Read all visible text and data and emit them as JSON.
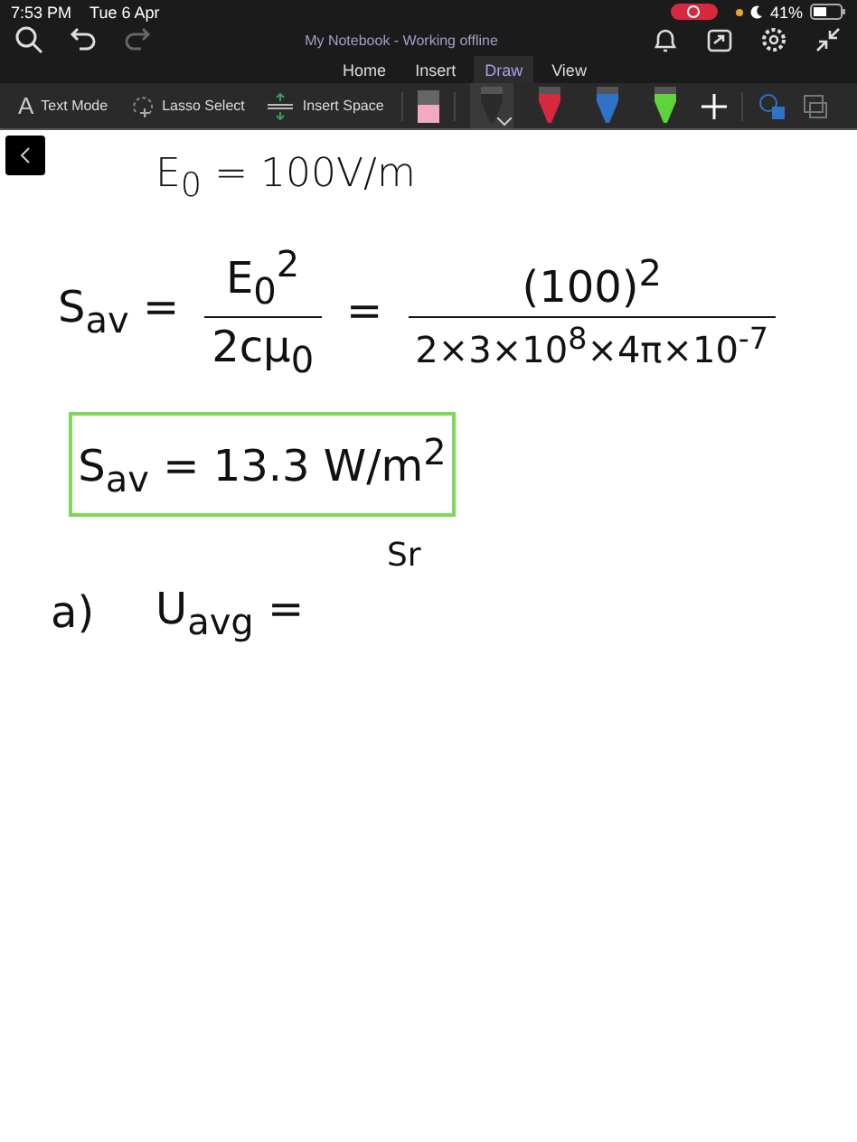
{
  "status_bar": {
    "time": "7:53 PM",
    "date": "Tue 6 Apr",
    "battery": "41%",
    "recording": true
  },
  "window": {
    "title": "My Notebook - Working offline"
  },
  "tabs": [
    {
      "label": "Home",
      "selected": false
    },
    {
      "label": "Insert",
      "selected": false
    },
    {
      "label": "Draw",
      "selected": true
    },
    {
      "label": "View",
      "selected": false
    }
  ],
  "tools": [
    {
      "label": "Text Mode",
      "kind": "text",
      "icon": "A"
    },
    {
      "label": "Lasso Select",
      "kind": "lasso"
    },
    {
      "label": "Insert Space",
      "kind": "space"
    }
  ],
  "pens": [
    {
      "color": "#2b2b2b",
      "selected": true
    },
    {
      "color": "#d8283f",
      "selected": false
    },
    {
      "color": "#2f73c8",
      "selected": false
    },
    {
      "color": "#5cd43c",
      "selected": false
    }
  ],
  "note": {
    "given": "E$_{0}$ = 100V/m",
    "lhs": "S$_{av}$ =",
    "frac1_num": "E$_{0}$$^{2}$",
    "frac1_den": "2cμ$_{0}$",
    "eq": "=",
    "frac2_num": "(100)$^{2}$",
    "frac2_den": "2×3×10$^{8}$×4π×10$^{-7}$",
    "result": "S$_{av}$ = 13.3 W/m$^{2}$",
    "part": "a)",
    "part_lhs": "U$_{avg}$ =",
    "part_rhs": "Sr"
  }
}
